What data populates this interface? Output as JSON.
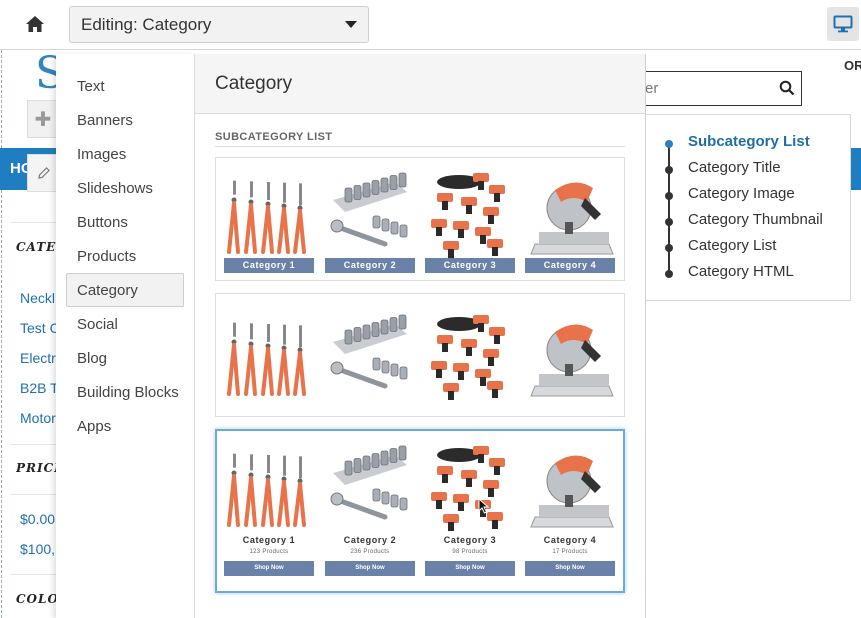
{
  "toolbar": {
    "editing_label": "Editing: Category",
    "home_icon": "home-icon",
    "desktop_icon": "desktop-icon"
  },
  "background_page": {
    "logo_letter": "S",
    "nav_home": "HO",
    "search_placeholder": "er",
    "orders_text": "OR",
    "sections": [
      {
        "heading": "CATEGORIES",
        "links": [
          "Neckl",
          "Test C",
          "Electr",
          "B2B T",
          "Motor"
        ]
      },
      {
        "heading": "PRICE",
        "links": [
          "$0.00",
          "$100,"
        ]
      },
      {
        "heading": "COLOR",
        "links": []
      }
    ]
  },
  "component_menu": {
    "items": [
      {
        "label": "Text"
      },
      {
        "label": "Banners"
      },
      {
        "label": "Images"
      },
      {
        "label": "Slideshows"
      },
      {
        "label": "Buttons"
      },
      {
        "label": "Products"
      },
      {
        "label": "Category",
        "active": true
      },
      {
        "label": "Social"
      },
      {
        "label": "Blog"
      },
      {
        "label": "Building Blocks"
      },
      {
        "label": "Apps"
      }
    ]
  },
  "main": {
    "title": "Category",
    "section_label": "SUBCATEGORY LIST",
    "cards": [
      {
        "style": "label-bar",
        "tiles": [
          {
            "name": "Category 1",
            "image": "pliers"
          },
          {
            "name": "Category 2",
            "image": "socket-set"
          },
          {
            "name": "Category 3",
            "image": "power-tools"
          },
          {
            "name": "Category 4",
            "image": "miter-saw"
          }
        ]
      },
      {
        "style": "image-only",
        "tiles": [
          {
            "image": "pliers"
          },
          {
            "image": "socket-set"
          },
          {
            "image": "power-tools"
          },
          {
            "image": "miter-saw"
          }
        ]
      },
      {
        "style": "detailed",
        "selected": true,
        "tiles": [
          {
            "name": "Category 1",
            "count": "123 Products",
            "button": "Shop Now",
            "image": "pliers"
          },
          {
            "name": "Category 2",
            "count": "236 Products",
            "button": "Shop Now",
            "image": "socket-set"
          },
          {
            "name": "Category 3",
            "count": "98 Products",
            "button": "Shop Now",
            "image": "power-tools"
          },
          {
            "name": "Category 4",
            "count": "17 Products",
            "button": "Shop Now",
            "image": "miter-saw"
          }
        ]
      }
    ]
  },
  "outline": {
    "items": [
      {
        "label": "Subcategory List",
        "active": true
      },
      {
        "label": "Category Title"
      },
      {
        "label": "Category Image"
      },
      {
        "label": "Category Thumbnail"
      },
      {
        "label": "Category List"
      },
      {
        "label": "Category HTML"
      }
    ]
  },
  "colors": {
    "accent": "#1f7ec1",
    "tile_bar": "#6b82a8",
    "tool_orange": "#e8734a",
    "active_outline": "#1f6fa5"
  }
}
